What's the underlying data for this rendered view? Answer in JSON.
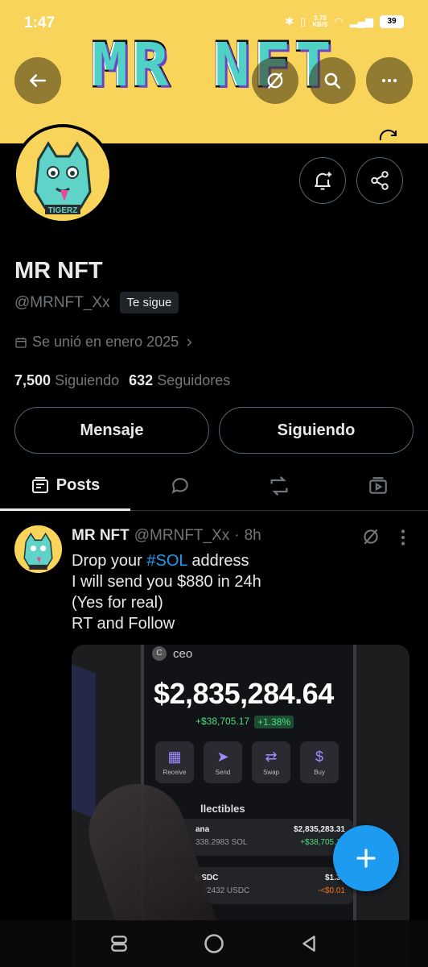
{
  "status_bar": {
    "time": "1:47",
    "speed_value": "3.78",
    "speed_unit": "KB/S",
    "battery": "39"
  },
  "banner": {
    "title": "MR NFT",
    "color": "#f8d45a"
  },
  "profile": {
    "display_name": "MR NFT",
    "handle": "@MRNFT_Xx",
    "follows_you": "Te sigue",
    "joined": "Se unió en enero 2025",
    "following_count": "7,500",
    "following_label": "Siguiendo",
    "followers_count": "632",
    "followers_label": "Seguidores"
  },
  "actions": {
    "message_label": "Mensaje",
    "following_label": "Siguiendo"
  },
  "tabs": [
    {
      "label": "Posts",
      "icon": "posts-icon",
      "active": true
    },
    {
      "label": "",
      "icon": "reply-icon",
      "active": false
    },
    {
      "label": "",
      "icon": "repost-icon",
      "active": false
    },
    {
      "label": "",
      "icon": "media-icon",
      "active": false
    }
  ],
  "post": {
    "name": "MR NFT",
    "handle": "@MRNFT_Xx",
    "time": "8h",
    "line1_prefix": "Drop your ",
    "line1_tag": "#SOL",
    "line1_suffix": " address",
    "line2": "I will send you $880 in 24h",
    "line3": "(Yes for real)",
    "line4": "RT and Follow"
  },
  "media": {
    "account": "ceo",
    "balance": "$2,835,284.64",
    "change": "+$38,705.17",
    "change_pct": "+1.38%",
    "actions": [
      "Receive",
      "Send",
      "Swap",
      "Buy"
    ],
    "collectibles": "llectibles",
    "asset1": {
      "name": "ana",
      "amount": "338.2983 SOL",
      "value": "$2,835,283.31",
      "delta": "+$38,705.17"
    },
    "asset2": {
      "name": "USDC",
      "amount": "1.32432 USDC",
      "value": "$1.32",
      "delta": "-<$0.01"
    }
  },
  "colors": {
    "accent": "#1d9bf0",
    "background": "#000000",
    "muted_text": "#71767b"
  }
}
